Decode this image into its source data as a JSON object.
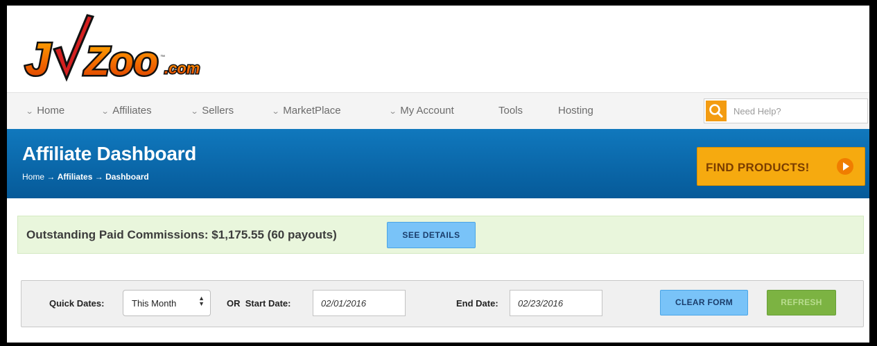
{
  "logo": {
    "text": "JVZoo",
    "suffix": ".com",
    "tm": "™"
  },
  "nav": {
    "items": [
      {
        "label": "Home",
        "dropdown": true
      },
      {
        "label": "Affiliates",
        "dropdown": true
      },
      {
        "label": "Sellers",
        "dropdown": true
      },
      {
        "label": "MarketPlace",
        "dropdown": true
      },
      {
        "label": "My Account",
        "dropdown": true
      },
      {
        "label": "Tools",
        "dropdown": false
      },
      {
        "label": "Hosting",
        "dropdown": false
      }
    ],
    "search_placeholder": "Need Help?",
    "chevron": "⌄"
  },
  "banner": {
    "title": "Affiliate Dashboard",
    "breadcrumb": [
      "Home",
      "Affiliates",
      "Dashboard"
    ],
    "breadcrumb_sep": "→",
    "find_products_label": "FIND PRODUCTS!"
  },
  "commission": {
    "text": "Outstanding Paid Commissions: $1,175.55 (60 payouts)",
    "details_label": "SEE DETAILS"
  },
  "filters": {
    "quick_dates_label": "Quick Dates:",
    "quick_dates_value": "This Month",
    "start_label": "OR  Start Date:",
    "start_value": "02/01/2016",
    "end_label": "End Date:",
    "end_value": "02/23/2016",
    "clear_label": "CLEAR FORM",
    "refresh_label": "REFRESH"
  },
  "colors": {
    "banner": "#065a99",
    "find_button": "#f6aa0f",
    "blue_button": "#79c3f8",
    "refresh_button": "#7cb342",
    "commission_bg": "#e9f6dc",
    "search_accent": "#f39c12"
  }
}
